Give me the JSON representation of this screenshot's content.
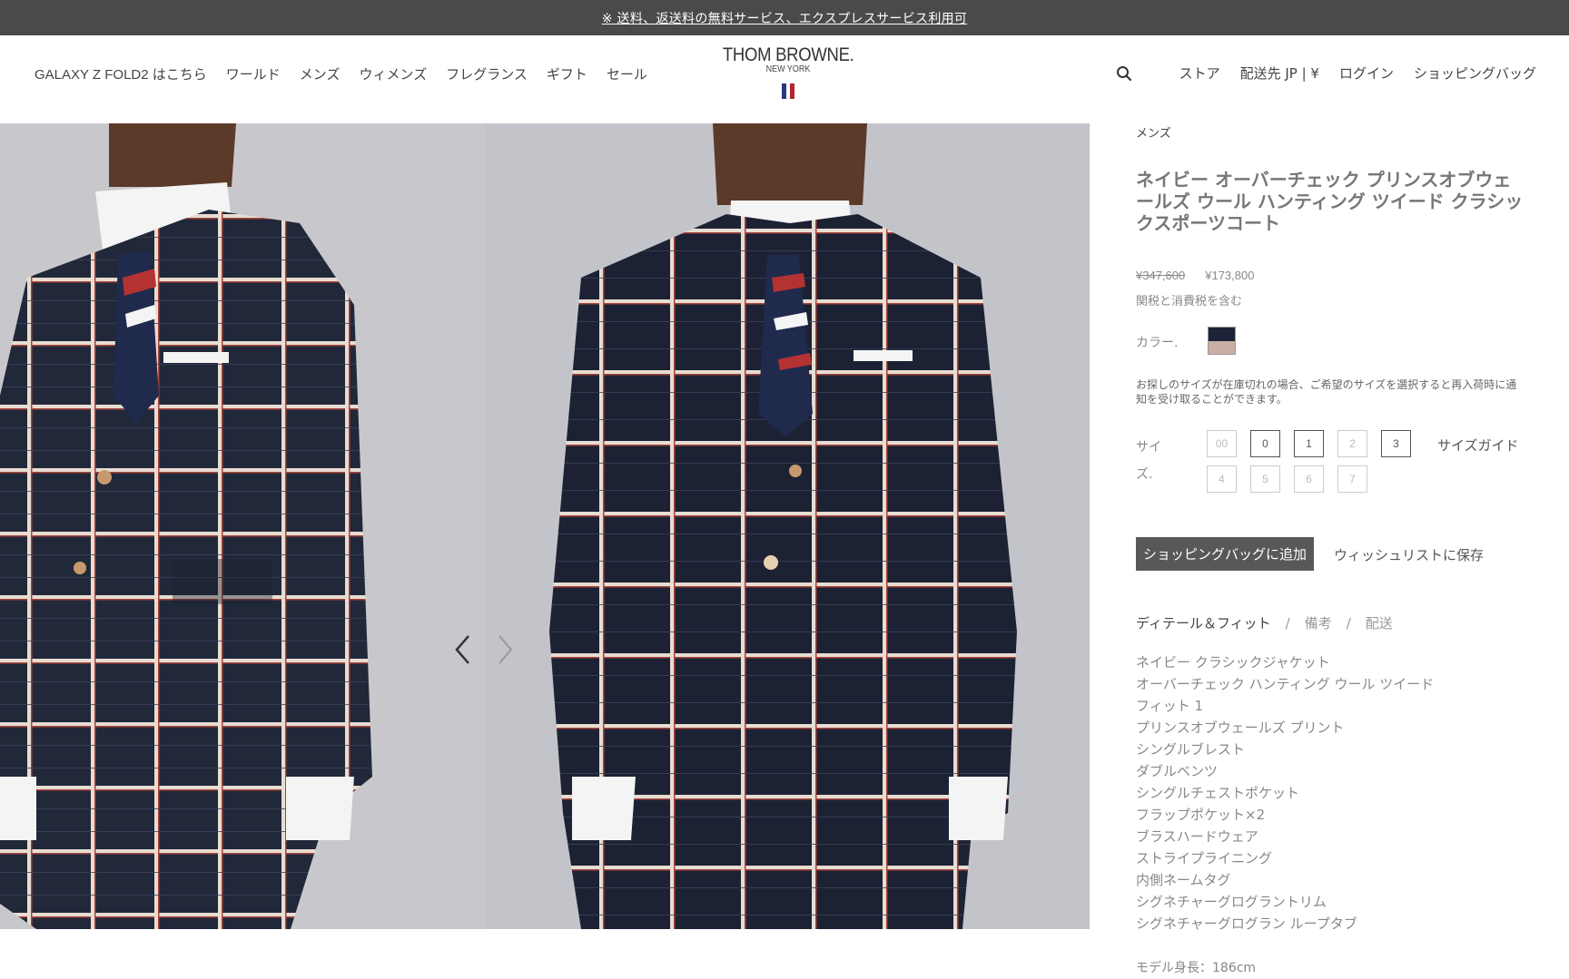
{
  "promo": {
    "text": "※ 送料、返送料の無料サービス、エクスプレスサービス利用可"
  },
  "nav_left": [
    "GALAXY Z FOLD2 はこちら",
    "ワールド",
    "メンズ",
    "ウィメンズ",
    "フレグランス",
    "ギフト",
    "セール"
  ],
  "logo": {
    "brand": "THOM BROWNE.",
    "city": "NEW YORK"
  },
  "nav_right": {
    "store": "ストア",
    "ship_to": "配送先 JP | ¥",
    "login": "ログイン",
    "bag": "ショッピングバッグ"
  },
  "product": {
    "breadcrumb": "メンズ",
    "title": "ネイビー オーバーチェック プリンスオブウェールズ ウール ハンティング ツイード クラシックスポーツコート",
    "price_original": "¥347,600",
    "price_sale": "¥173,800",
    "tax_note": "関税と消費税を含む",
    "color_label": "カラー.",
    "swatch_colors": {
      "top": "#1d2236",
      "bottom": "#c9aea3"
    },
    "notice": "お探しのサイズが在庫切れの場合、ご希望のサイズを選択すると再入荷時に通知を受け取ることができます。",
    "size_label": "サイズ.",
    "sizes": [
      {
        "label": "00",
        "available": false
      },
      {
        "label": "0",
        "available": true
      },
      {
        "label": "1",
        "available": true
      },
      {
        "label": "2",
        "available": false
      },
      {
        "label": "3",
        "available": true
      },
      {
        "label": "4",
        "available": false
      },
      {
        "label": "5",
        "available": false
      },
      {
        "label": "6",
        "available": false
      },
      {
        "label": "7",
        "available": false
      }
    ],
    "size_guide": "サイズガイド",
    "add_to_bag": "ショッピングバッグに追加",
    "wishlist": "ウィッシュリストに保存",
    "tabs": [
      "ディテール＆フィット",
      "備考",
      "配送"
    ],
    "tab_separator": "/",
    "details": [
      "ネイビー クラシックジャケット",
      "オーバーチェック ハンティング ウール ツイード",
      "フィット 1",
      "プリンスオブウェールズ プリント",
      "シングルブレスト",
      "ダブルベンツ",
      "シングルチェストポケット",
      "フラップポケット×2",
      "ブラスハードウェア",
      "ストライプライニング",
      "内側ネームタグ",
      "シグネチャーグログラントリム",
      "シグネチャーグログラン ループタブ"
    ],
    "model_height": "モデル身長：186cm"
  },
  "gallery": {
    "images": [
      "jacket-side-photo",
      "jacket-front-photo"
    ],
    "colors": {
      "bg_left": "#c8c8cc",
      "bg_right": "#c3c4c9",
      "navy": "#1c2233",
      "cream": "#e8ddd2",
      "red": "#a8443c",
      "shirt": "#f4f4f4",
      "skin": "#5b3a2a"
    }
  },
  "icons": {
    "search": "search-icon",
    "prev": "chevron-left-icon",
    "next": "chevron-right-icon"
  }
}
